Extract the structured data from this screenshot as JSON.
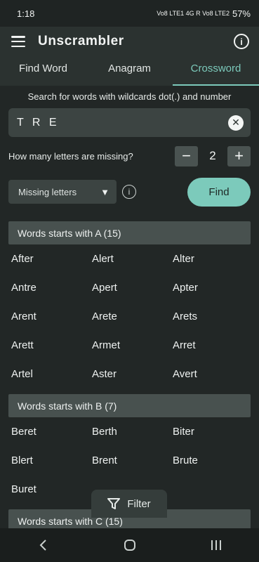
{
  "status": {
    "time": "1:18",
    "signals": "Vo8 LTE1 4G R Vo8 LTE2",
    "battery": "57%"
  },
  "app": {
    "title": "Unscrambler"
  },
  "tabs": [
    {
      "label": "Find Word"
    },
    {
      "label": "Anagram"
    },
    {
      "label": "Crossword"
    }
  ],
  "search": {
    "hint": "Search for words with wildcards dot(.) and number",
    "value": "T R E"
  },
  "missing": {
    "label": "How many letters are missing?",
    "minus": "−",
    "value": "2",
    "plus": "+"
  },
  "mode": {
    "selected": "Missing letters"
  },
  "find_label": "Find",
  "groups": [
    {
      "title": "Words starts with A (15)",
      "words": [
        "After",
        "Alert",
        "Alter",
        "Antre",
        "Apert",
        "Apter",
        "Arent",
        "Arete",
        "Arets",
        "Arett",
        "Armet",
        "Arret",
        "Artel",
        "Aster",
        "Avert"
      ]
    },
    {
      "title": "Words starts with B (7)",
      "words": [
        "Beret",
        "Berth",
        "Biter",
        "Blert",
        "Brent",
        "Brute",
        "Buret"
      ]
    },
    {
      "title": "Words starts with C (15)",
      "words": []
    }
  ],
  "filter_label": "Filter",
  "accent_color": "#7ccabb"
}
